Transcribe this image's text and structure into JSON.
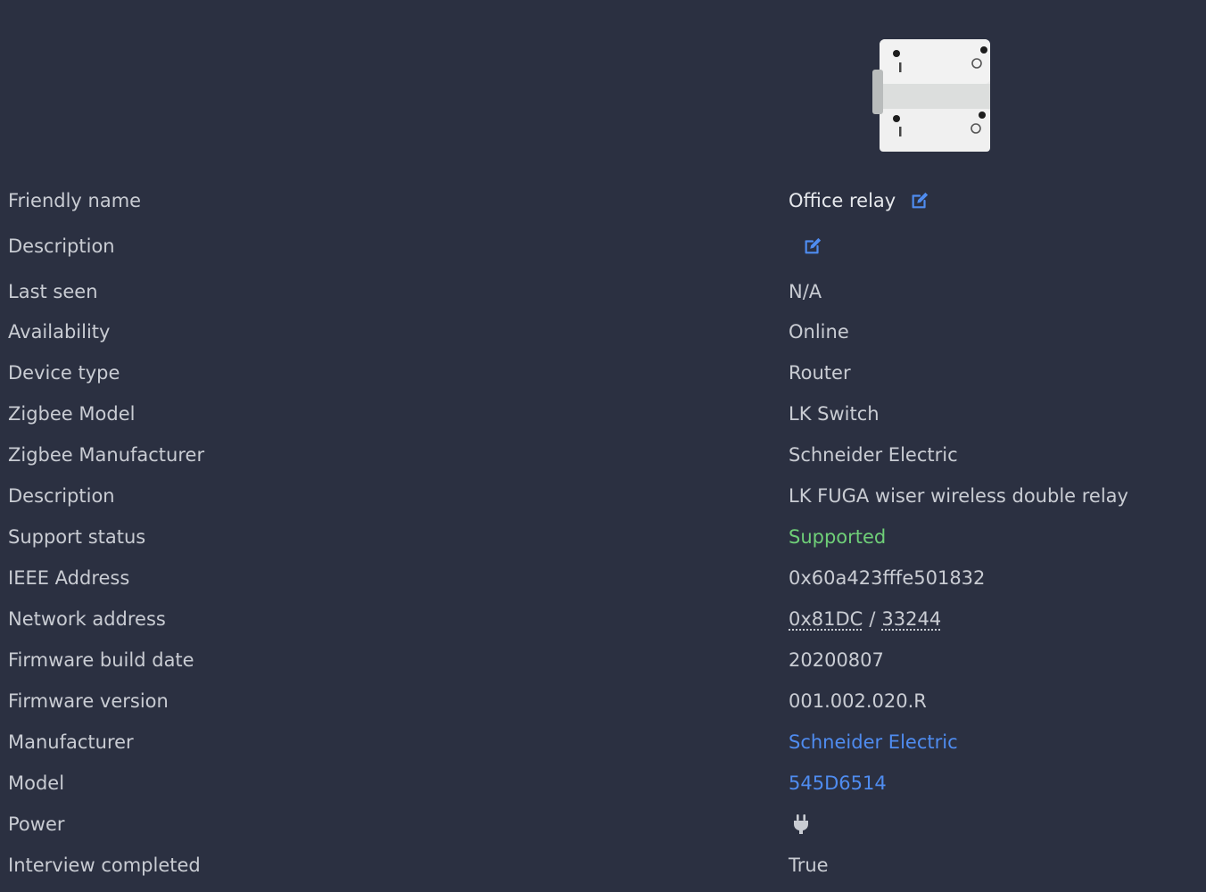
{
  "device": {
    "image_icon": "relay-switch-image"
  },
  "rows": [
    {
      "label": "Friendly name",
      "value": "Office relay"
    },
    {
      "label": "Description",
      "value": ""
    },
    {
      "label": "Last seen",
      "value": "N/A"
    },
    {
      "label": "Availability",
      "value": "Online"
    },
    {
      "label": "Device type",
      "value": "Router"
    },
    {
      "label": "Zigbee Model",
      "value": "LK Switch"
    },
    {
      "label": "Zigbee Manufacturer",
      "value": "Schneider Electric"
    },
    {
      "label": "Description",
      "value": "LK FUGA wiser wireless double relay"
    },
    {
      "label": "Support status",
      "value": "Supported"
    },
    {
      "label": "IEEE Address",
      "value": "0x60a423fffe501832"
    },
    {
      "label": "Network address",
      "value_hex": "0x81DC",
      "value_sep": "/",
      "value_dec": "33244"
    },
    {
      "label": "Firmware build date",
      "value": "20200807"
    },
    {
      "label": "Firmware version",
      "value": "001.002.020.R"
    },
    {
      "label": "Manufacturer",
      "value": "Schneider Electric"
    },
    {
      "label": "Model",
      "value": "545D6514"
    },
    {
      "label": "Power",
      "value_icon": "plug-icon"
    },
    {
      "label": "Interview completed",
      "value": "True"
    }
  ],
  "colors": {
    "background": "#2b3041",
    "text": "#c9ccd3",
    "supported": "#6fcf78",
    "link": "#4f8cf0"
  }
}
